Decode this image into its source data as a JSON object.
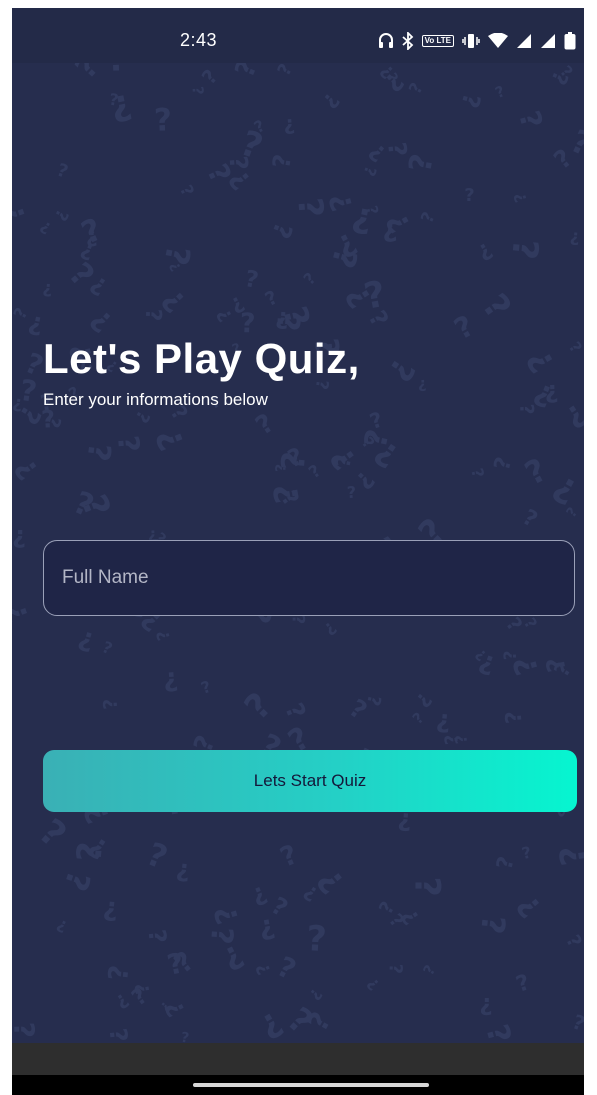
{
  "status_bar": {
    "time": "2:43",
    "lte_badge": "Vo LTE",
    "icons": [
      "headset-icon",
      "bluetooth-icon",
      "volte-icon",
      "vibrate-icon",
      "wifi-icon",
      "signal-icon",
      "signal-icon",
      "battery-icon"
    ]
  },
  "main": {
    "title": "Let's Play Quiz,",
    "subtitle": "Enter your informations below",
    "name_field": {
      "placeholder": "Full Name",
      "value": ""
    },
    "start_button_label": "Lets Start Quiz"
  },
  "colors": {
    "background": "#262d4e",
    "input_fill": "#1f2547",
    "button_gradient_start": "#3ab0b5",
    "button_gradient_end": "#06f5d0",
    "pattern": "#313a5e"
  }
}
